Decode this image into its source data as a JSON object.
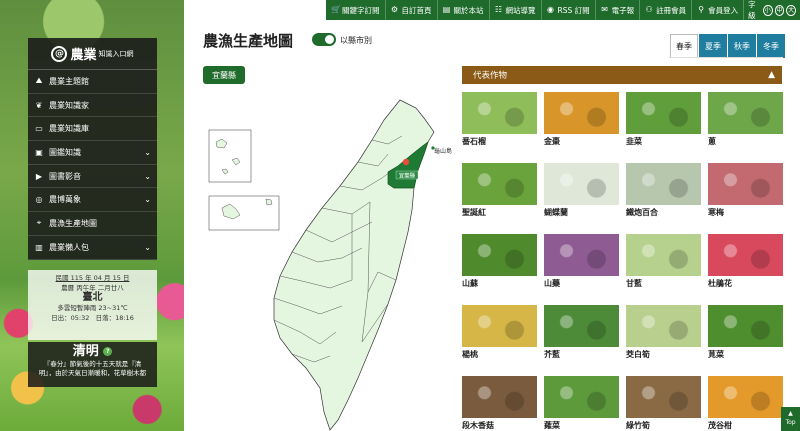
{
  "topbar": {
    "items": [
      {
        "label": "關鍵字訂閱",
        "icon": "cart-icon"
      },
      {
        "label": "自訂首頁",
        "icon": "gear-icon"
      },
      {
        "label": "關於本站",
        "icon": "book-icon"
      },
      {
        "label": "網站導覽",
        "icon": "sitemap-icon"
      },
      {
        "label": "RSS 訂閱",
        "icon": "rss-icon"
      },
      {
        "label": "電子報",
        "icon": "mail-icon"
      },
      {
        "label": "註冊會員",
        "icon": "user-add-icon"
      },
      {
        "label": "會員登入",
        "icon": "user-icon"
      }
    ],
    "font_label": "字級",
    "font_sizes": [
      "小",
      "中",
      "大"
    ]
  },
  "logo": {
    "main": "農業",
    "sub": "知識入口網"
  },
  "sidebar": {
    "items": [
      {
        "label": "農業主題館",
        "icon": "field-icon",
        "expand": false
      },
      {
        "label": "農業知識家",
        "icon": "wheat-icon",
        "expand": false
      },
      {
        "label": "農業知識庫",
        "icon": "archive-icon",
        "expand": false
      },
      {
        "label": "圖鑑知識",
        "icon": "picture-icon",
        "expand": true
      },
      {
        "label": "圖書影音",
        "icon": "media-icon",
        "expand": true
      },
      {
        "label": "農博萬象",
        "icon": "globe-icon",
        "expand": true
      },
      {
        "label": "農漁生產地圖",
        "icon": "map-pin-icon",
        "expand": false
      },
      {
        "label": "農業懶人包",
        "icon": "package-icon",
        "expand": true
      }
    ]
  },
  "dateinfo": {
    "line1": "民國 115 年 04 月 15 日",
    "line2": "農曆 丙午年 二月廿八",
    "city": "臺北",
    "weather": "多雲短暫陣雨 23~31℃",
    "sunrise": "日出：05:32",
    "sunset": "日落：18:16"
  },
  "solar_term": {
    "name": "清明",
    "help": "?",
    "text1": "『春分』節氣後的十五天就是『清",
    "text2": "明』，由於天氣日漸暖和，花草樹木都"
  },
  "main": {
    "title": "農漁生產地圖",
    "toggle_label": "以縣市別",
    "county_button": "宜蘭縣",
    "selected_county": "宜蘭縣",
    "island_label": "龜山島",
    "tabs": [
      "春季",
      "夏季",
      "秋季",
      "冬季"
    ],
    "active_tab": 0
  },
  "crops": {
    "heading": "代表作物",
    "items": [
      {
        "name": "番石榴",
        "color": "#8fbd5a",
        "icon": "guava-photo"
      },
      {
        "name": "金棗",
        "color": "#d8962a",
        "icon": "kumquat-photo"
      },
      {
        "name": "韭菜",
        "color": "#5f9e3a",
        "icon": "chive-photo"
      },
      {
        "name": "蔥",
        "color": "#6ea64a",
        "icon": "scallion-photo"
      },
      {
        "name": "聖誕紅",
        "color": "#6aa33c",
        "icon": "poinsettia-photo"
      },
      {
        "name": "蝴蝶蘭",
        "color": "#dfe8d8",
        "icon": "orchid-photo"
      },
      {
        "name": "鐵炮百合",
        "color": "#b7c7ae",
        "icon": "lily-photo"
      },
      {
        "name": "寒梅",
        "color": "#c26a70",
        "icon": "plum-blossom-photo"
      },
      {
        "name": "山蘇",
        "color": "#4f8a2c",
        "icon": "bird-nest-fern-photo"
      },
      {
        "name": "山藥",
        "color": "#8e5b92",
        "icon": "yam-photo"
      },
      {
        "name": "甘藍",
        "color": "#b6d18e",
        "icon": "cabbage-photo"
      },
      {
        "name": "杜鵑花",
        "color": "#d8495e",
        "icon": "azalea-photo"
      },
      {
        "name": "楊桃",
        "color": "#d5b646",
        "icon": "starfruit-photo"
      },
      {
        "name": "芥藍",
        "color": "#4d8b38",
        "icon": "kale-photo"
      },
      {
        "name": "茭白筍",
        "color": "#b8cf8e",
        "icon": "water-bamboo-photo"
      },
      {
        "name": "莧菜",
        "color": "#4f8e2e",
        "icon": "amaranth-photo"
      },
      {
        "name": "段木香菇",
        "color": "#7a5b3d",
        "icon": "shiitake-photo"
      },
      {
        "name": "蕹菜",
        "color": "#5d9a3c",
        "icon": "water-spinach-photo"
      },
      {
        "name": "綠竹筍",
        "color": "#8a6a45",
        "icon": "bamboo-shoot-photo"
      },
      {
        "name": "茂谷柑",
        "color": "#e49a2a",
        "icon": "murcott-photo"
      }
    ]
  },
  "top_button": "Top"
}
